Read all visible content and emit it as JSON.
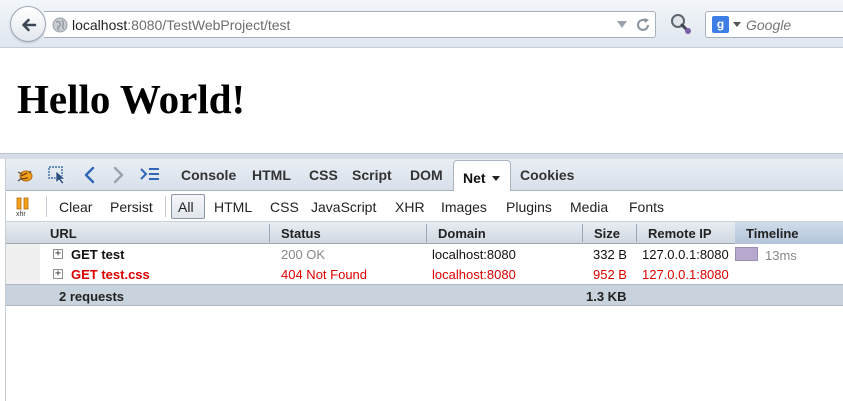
{
  "browser": {
    "url_host": "localhost",
    "url_rest": ":8080/TestWebProject/test",
    "search_placeholder": "Google",
    "search_engine_letter": "g"
  },
  "page": {
    "heading": "Hello World!"
  },
  "firebug": {
    "tabs": [
      "Console",
      "HTML",
      "CSS",
      "Script",
      "DOM",
      "Net",
      "Cookies"
    ],
    "active_tab": "Net",
    "filter_bar": {
      "buttons": [
        "Clear",
        "Persist"
      ],
      "filters": [
        "All",
        "HTML",
        "CSS",
        "JavaScript",
        "XHR",
        "Images",
        "Plugins",
        "Media",
        "Fonts"
      ],
      "active_filter": "All"
    },
    "net": {
      "columns": [
        "URL",
        "Status",
        "Domain",
        "Size",
        "Remote IP",
        "Timeline"
      ],
      "requests": [
        {
          "url": "GET test",
          "status": "200 OK",
          "domain": "localhost:8080",
          "size": "332 B",
          "remote_ip": "127.0.0.1:8080",
          "timeline": "13ms",
          "state": "ok"
        },
        {
          "url": "GET test.css",
          "status": "404 Not Found",
          "domain": "localhost:8080",
          "size": "952 B",
          "remote_ip": "127.0.0.1:8080",
          "timeline": "",
          "state": "error"
        }
      ],
      "summary": {
        "requests": "2 requests",
        "total_size": "1.3 KB"
      }
    }
  },
  "colors": {
    "error_text": "#dd0000",
    "timeline_bar": "#b7a9cd"
  }
}
